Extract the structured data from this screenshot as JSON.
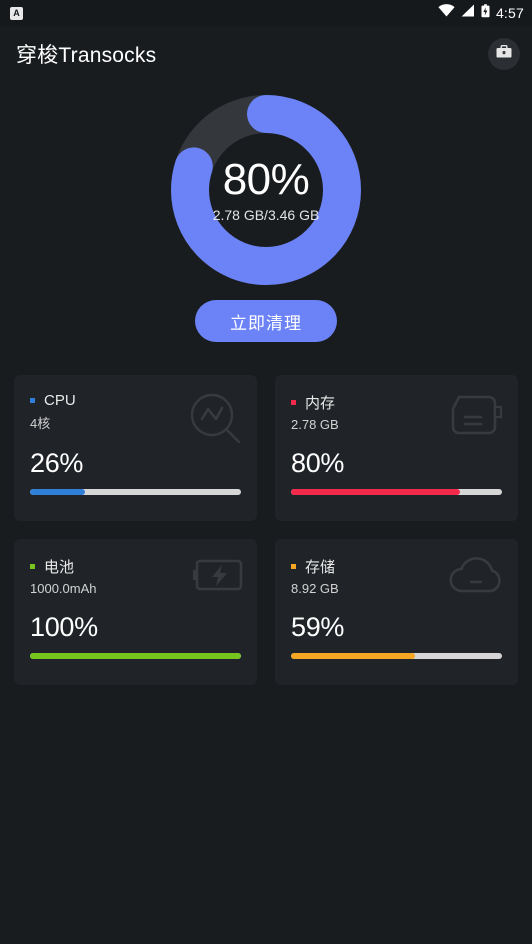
{
  "statusbar": {
    "app_badge_letter": "A",
    "time": "4:57",
    "icons": [
      "wifi-icon",
      "signal-icon",
      "battery-charging-icon"
    ]
  },
  "appbar": {
    "title": "穿梭Transocks",
    "action_icon": "toolbox-icon"
  },
  "donut": {
    "percent_label": "80%",
    "percent_value": 80,
    "detail": "2.78 GB/3.46 GB",
    "used": "2.78 GB",
    "total": "3.46 GB",
    "arc_color": "#6c83f7",
    "track_color": "#34383d"
  },
  "clean_button": {
    "label": "立即清理"
  },
  "cards": [
    {
      "name": "cpu",
      "title": "CPU",
      "subtitle": "4核",
      "percent_label": "26%",
      "percent_value": 26,
      "accent": "#2f7fd8",
      "icon": "cpu-monitor-icon"
    },
    {
      "name": "memory",
      "title": "内存",
      "subtitle": "2.78 GB",
      "percent_label": "80%",
      "percent_value": 80,
      "accent": "#f2294b",
      "icon": "memory-chip-icon"
    },
    {
      "name": "battery",
      "title": "电池",
      "subtitle": "1000.0mAh",
      "percent_label": "100%",
      "percent_value": 100,
      "accent": "#76c61d",
      "icon": "battery-charging-icon"
    },
    {
      "name": "storage",
      "title": "存储",
      "subtitle": "8.92 GB",
      "percent_label": "59%",
      "percent_value": 59,
      "accent": "#f5a623",
      "icon": "cloud-icon"
    }
  ],
  "theme": {
    "page_bg": "#191c1f",
    "card_bg": "#202428",
    "accent_blue": "#6c83f7",
    "track_gray": "#d6d6d6"
  }
}
